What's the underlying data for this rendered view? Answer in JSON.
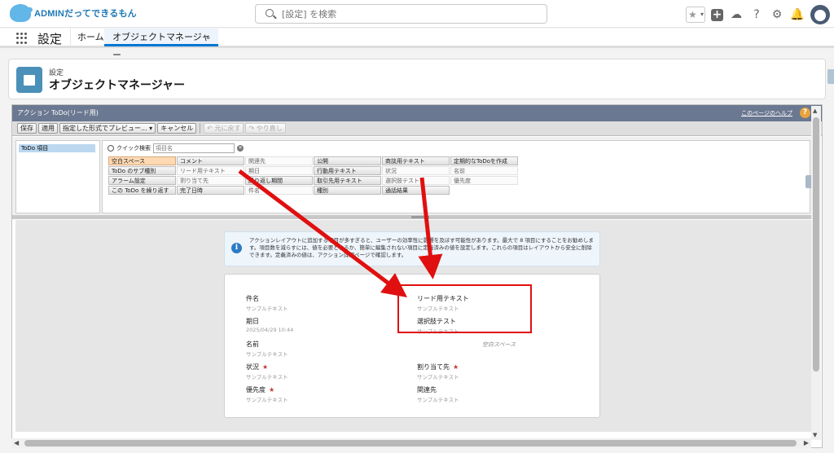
{
  "brand": {
    "logo_text": "ADMINだってできるもん"
  },
  "search": {
    "placeholder": "[設定] を検索"
  },
  "app": {
    "name": "設定"
  },
  "nav": {
    "home": "ホーム",
    "active_tab": "オブジェクトマネージャー"
  },
  "page": {
    "breadcrumb": "設定",
    "title": "オブジェクトマネージャー"
  },
  "editor": {
    "title": "アクション ToDo(リード用)",
    "help_link": "このページのヘルプ",
    "toolbar": {
      "save": "保存",
      "quick_save": "適用",
      "preview": "指定した形式でプレビュー...",
      "cancel": "キャンセル",
      "undo": "元に戻す",
      "redo": "やり直し"
    },
    "palette": {
      "category": "ToDo 項目",
      "quick_find_label": "クイック検索",
      "quick_find_placeholder": "項目名",
      "items": [
        {
          "label": "空白スペース",
          "kind": "hl"
        },
        {
          "label": "コメント",
          "kind": "b"
        },
        {
          "label": "関連先",
          "kind": "p"
        },
        {
          "label": "公開",
          "kind": "b"
        },
        {
          "label": "商談用テキスト",
          "kind": "b"
        },
        {
          "label": "定期的なToDoを作成",
          "kind": "b"
        },
        {
          "label": "ToDo のサブ種別",
          "kind": "b"
        },
        {
          "label": "リード用テキスト",
          "kind": "p"
        },
        {
          "label": "期日",
          "kind": "p"
        },
        {
          "label": "行動用テキスト",
          "kind": "b"
        },
        {
          "label": "状況",
          "kind": "p"
        },
        {
          "label": "名前",
          "kind": "p"
        },
        {
          "label": "アラーム設定",
          "kind": "b"
        },
        {
          "label": "割り当て先",
          "kind": "p"
        },
        {
          "label": "繰り返し期間",
          "kind": "b"
        },
        {
          "label": "取引先用テキスト",
          "kind": "b"
        },
        {
          "label": "選択肢テスト",
          "kind": "p"
        },
        {
          "label": "優先度",
          "kind": "p"
        },
        {
          "label": "この ToDo を繰り返す",
          "kind": "b"
        },
        {
          "label": "完了日時",
          "kind": "b"
        },
        {
          "label": "件名",
          "kind": "p"
        },
        {
          "label": "種別",
          "kind": "b"
        },
        {
          "label": "通話結果",
          "kind": "b"
        },
        {
          "label": "",
          "kind": ""
        }
      ]
    },
    "info_message": "アクションレイアウトに追加する項目が多すぎると、ユーザーの効率性に影響を及ぼす可能性があります。最大で 8 項目にすることをお勧めします。項目数を減らすには、値を必要とするか、簡単に編集されない項目に定義済みの値を設定します。これらの項目はレイアウトから安全に削除できます。定義済みの値は、アクション詳細ページで確認します。",
    "layout": {
      "left": [
        {
          "label": "件名",
          "value": "サンプルテキスト",
          "required": ""
        },
        {
          "label": "期日",
          "value": "2025/04/29 10:44",
          "required": ""
        },
        {
          "label": "名前",
          "value": "サンプルテキスト",
          "required": ""
        },
        {
          "label": "状況",
          "value": "サンプルテキスト",
          "required": "★"
        },
        {
          "label": "優先度",
          "value": "サンプルテキスト",
          "required": "★"
        }
      ],
      "right": [
        {
          "label": "リード用テキスト",
          "value": "サンプルテキスト",
          "required": ""
        },
        {
          "label": "選択肢テスト",
          "value": "サンプルテキスト",
          "required": ""
        },
        {
          "label": "割り当て先",
          "value": "サンプルテキスト",
          "required": "★"
        },
        {
          "label": "関連先",
          "value": "サンプルテキスト",
          "required": ""
        }
      ],
      "blank_space": "空白スペース"
    }
  },
  "annotation": {
    "color": "#e01010"
  },
  "colors": {
    "accent": "#0176d3",
    "editor_bar": "#6b7891",
    "required": "#c23934"
  }
}
